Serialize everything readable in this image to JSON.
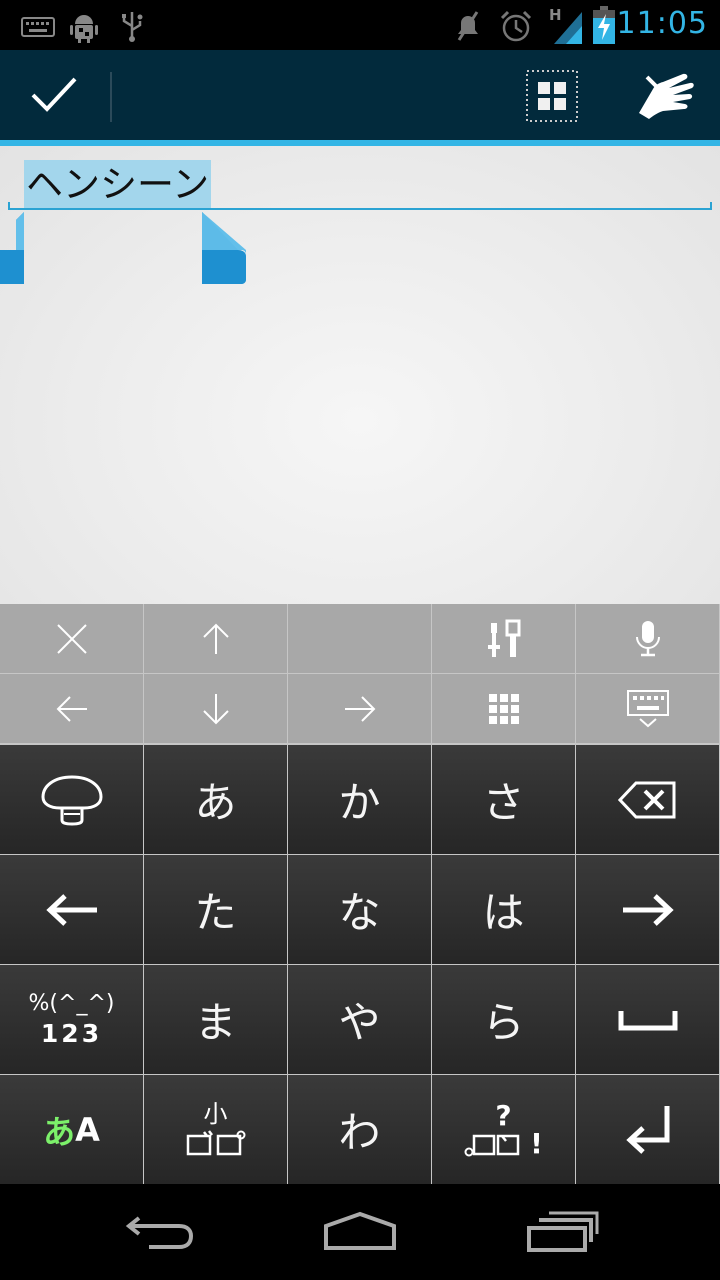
{
  "status_bar": {
    "time": "11:05",
    "network_type": "H",
    "icons": [
      "keyboard-icon",
      "android-debug-icon",
      "usb-icon",
      "mute-icon",
      "alarm-icon",
      "signal-icon",
      "battery-charging-icon"
    ],
    "accent": "#33b5e5"
  },
  "action_bar": {
    "background": "#022a3c",
    "actions": [
      "done-check-icon",
      "select-all-grid-icon",
      "hand-icon"
    ]
  },
  "editor": {
    "text": "ヘンシーン",
    "selection_color": "#a3d6ec",
    "underline_color": "#2ba3d3"
  },
  "keyboard": {
    "tool_row1": [
      "close-icon",
      "arrow-up-icon",
      "",
      "tools-icon",
      "microphone-icon"
    ],
    "tool_row2": [
      "arrow-left-icon",
      "arrow-down-icon",
      "arrow-right-icon",
      "grid-icon",
      "keyboard-hide-icon"
    ],
    "rows": [
      [
        "mushroom-icon",
        "あ",
        "か",
        "さ",
        "backspace-icon"
      ],
      [
        "cursor-left-icon",
        "た",
        "な",
        "は",
        "cursor-right-icon"
      ],
      [
        "symbols-numbers",
        "ま",
        "や",
        "ら",
        "space-icon"
      ],
      [
        "mode-toggle",
        "small-dakuten",
        "わ",
        "punctuation",
        "enter-icon"
      ]
    ],
    "symbols_label_top": "%(^_^)",
    "symbols_label_bottom": "123",
    "mode_label_kana": "あ",
    "mode_label_latin": "A",
    "mode_kana_color": "#7cf06a",
    "small_label": "小",
    "question_label": "?",
    "exclaim_label": "!"
  },
  "nav_bar": {
    "buttons": [
      "back-icon",
      "home-icon",
      "recent-apps-icon"
    ]
  }
}
